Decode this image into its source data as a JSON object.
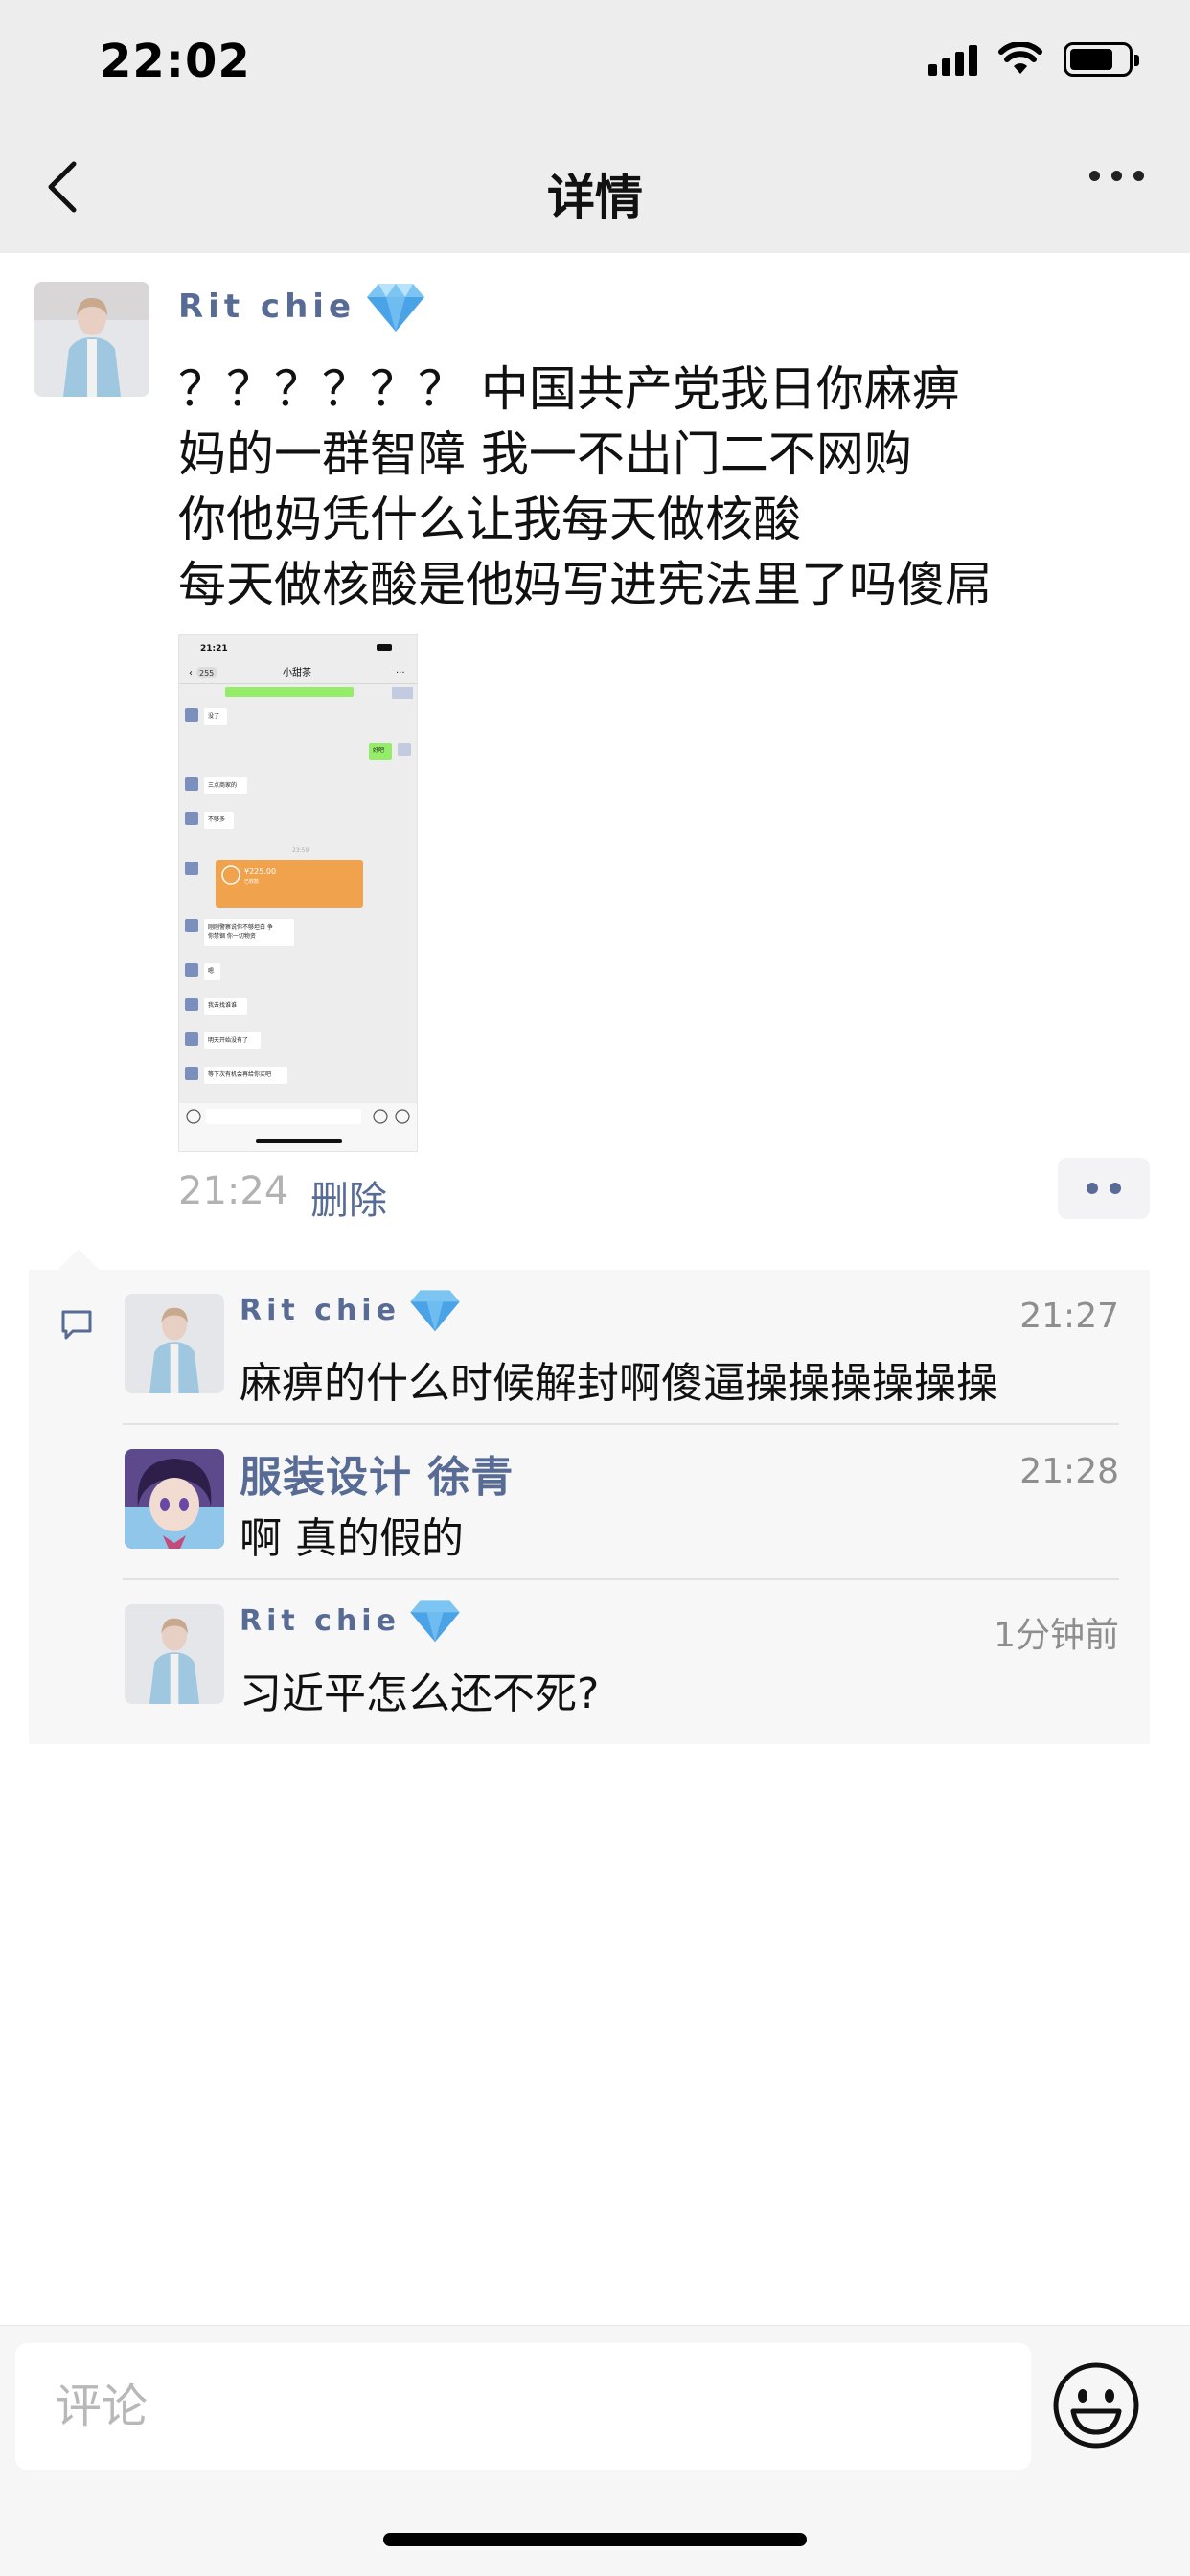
{
  "status_bar": {
    "time": "22:02"
  },
  "nav": {
    "title": "详情"
  },
  "post": {
    "author": "Rit chie",
    "text_lines": [
      "？？？？？？ 中国共产党我日你麻痹",
      "妈的一群智障 我一不出门二不网购",
      "你他妈凭什么让我每天做核酸",
      "每天做核酸是他妈写进宪法里了吗傻屌"
    ],
    "time": "21:24",
    "delete_label": "删除",
    "screenshot": {
      "status_time": "21:21",
      "back_badge": "255",
      "chat_title": "小甜茶",
      "messages": [
        {
          "side": "left",
          "text": "没了"
        },
        {
          "side": "right",
          "text": "好吧"
        },
        {
          "side": "left",
          "text": "三点商家的"
        },
        {
          "side": "left",
          "text": "不够多"
        },
        {
          "side": "center",
          "text": "23:59"
        },
        {
          "side": "left",
          "text": "¥225.00",
          "kind": "transfer",
          "sub": "已收款"
        },
        {
          "side": "left",
          "text": "刚刚警察说你不够坦白 争你禁锢 你一切物资"
        },
        {
          "side": "left",
          "text": "嗯"
        },
        {
          "side": "left",
          "text": "我去找谁谁"
        },
        {
          "side": "left",
          "text": "明天开始没有了"
        },
        {
          "side": "left",
          "text": "等下次有机会再给你买吧"
        }
      ]
    }
  },
  "comments": [
    {
      "author": "Rit chie",
      "time": "21:27",
      "text": "麻痹的什么时候解封啊傻逼操操操操操操"
    },
    {
      "author": "服装设计 徐青",
      "time": "21:28",
      "text": "啊 真的假的"
    },
    {
      "author": "Rit chie",
      "time": "1分钟前",
      "text": "习近平怎么还不死?"
    }
  ],
  "input": {
    "placeholder": "评论"
  },
  "colors": {
    "link": "#576b95",
    "background_bar": "#ededed",
    "comment_bg": "#f7f7f7"
  }
}
